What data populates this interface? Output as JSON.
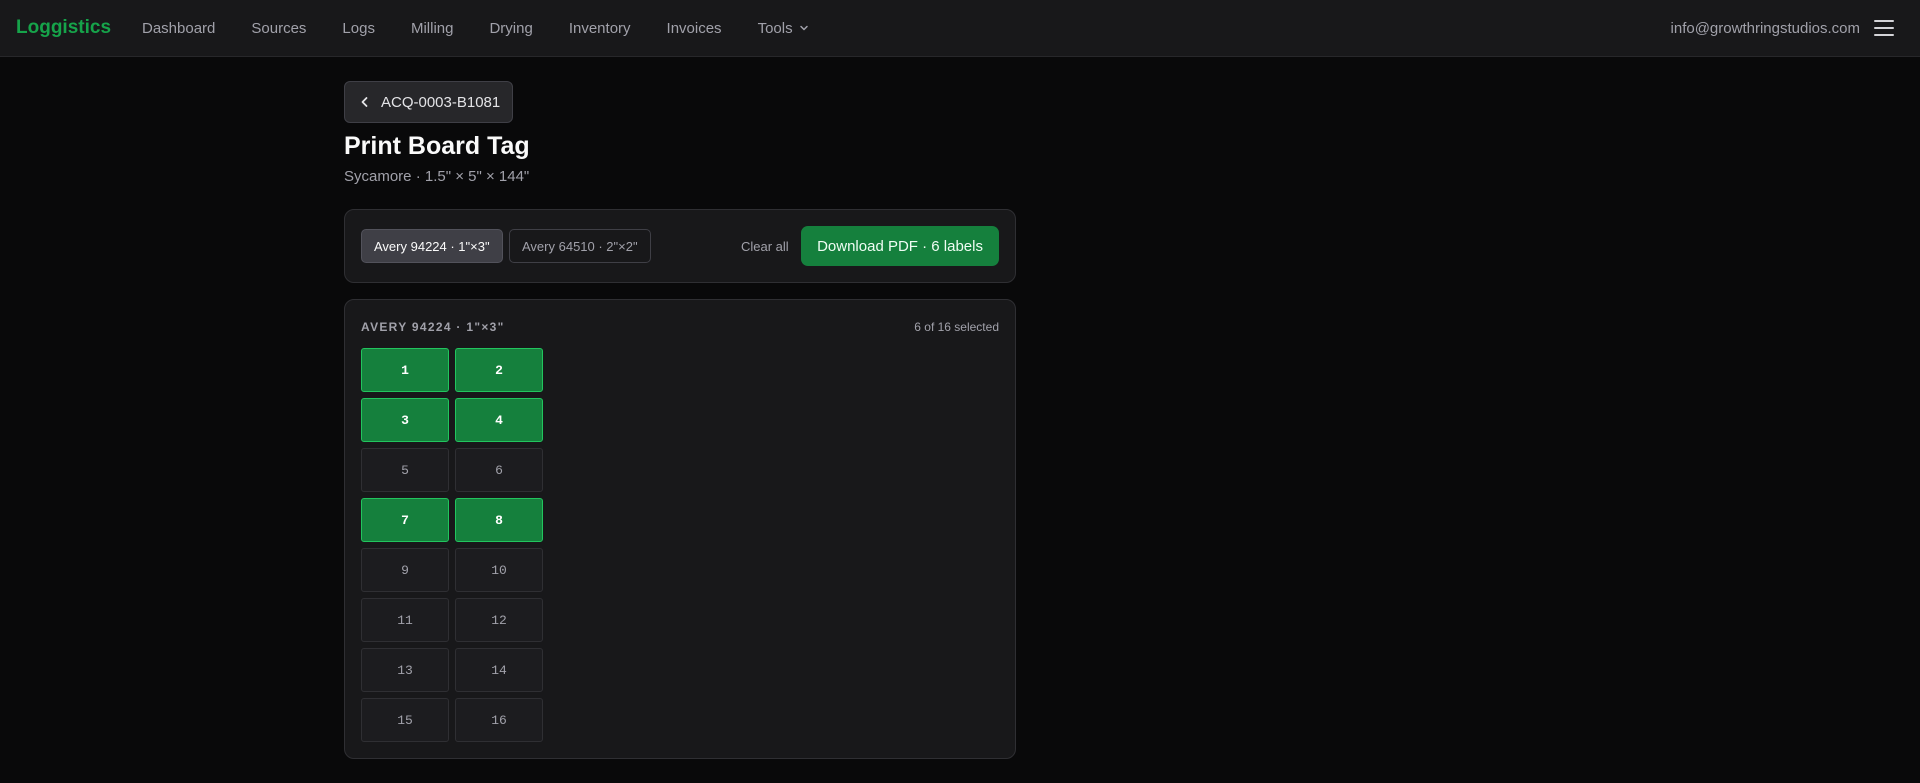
{
  "nav": {
    "brand": "Loggistics",
    "links": [
      {
        "label": "Dashboard"
      },
      {
        "label": "Sources"
      },
      {
        "label": "Logs"
      },
      {
        "label": "Milling"
      },
      {
        "label": "Drying"
      },
      {
        "label": "Inventory"
      },
      {
        "label": "Invoices"
      },
      {
        "label": "Tools"
      }
    ],
    "email": "info@growthringstudios.com",
    "menu_icon": "hamburger-menu-icon"
  },
  "back": {
    "label": "ACQ-0003-B1081",
    "icon": "chevron-left-icon"
  },
  "page": {
    "title": "Print Board Tag",
    "subtitle": "Sycamore · 1.5\" × 5\" × 144\""
  },
  "toolbar": {
    "formats": [
      {
        "label": "Avery 94224 · 1\"×3\"",
        "active": true
      },
      {
        "label": "Avery 64510 · 2\"×2\"",
        "active": false
      }
    ],
    "clear_label": "Clear all",
    "download_label": "Download PDF · 6 labels"
  },
  "sheet": {
    "title": "AVERY 94224 · 1\"×3\"",
    "count": "6 of 16 selected",
    "labels": [
      {
        "n": "1",
        "selected": true
      },
      {
        "n": "2",
        "selected": true
      },
      {
        "n": "3",
        "selected": true
      },
      {
        "n": "4",
        "selected": true
      },
      {
        "n": "5",
        "selected": false
      },
      {
        "n": "6",
        "selected": false
      },
      {
        "n": "7",
        "selected": true
      },
      {
        "n": "8",
        "selected": true
      },
      {
        "n": "9",
        "selected": false
      },
      {
        "n": "10",
        "selected": false
      },
      {
        "n": "11",
        "selected": false
      },
      {
        "n": "12",
        "selected": false
      },
      {
        "n": "13",
        "selected": false
      },
      {
        "n": "14",
        "selected": false
      },
      {
        "n": "15",
        "selected": false
      },
      {
        "n": "16",
        "selected": false
      }
    ]
  },
  "colors": {
    "accent": "#16a34a",
    "selected_fill": "#15803d",
    "background": "#09090a"
  }
}
